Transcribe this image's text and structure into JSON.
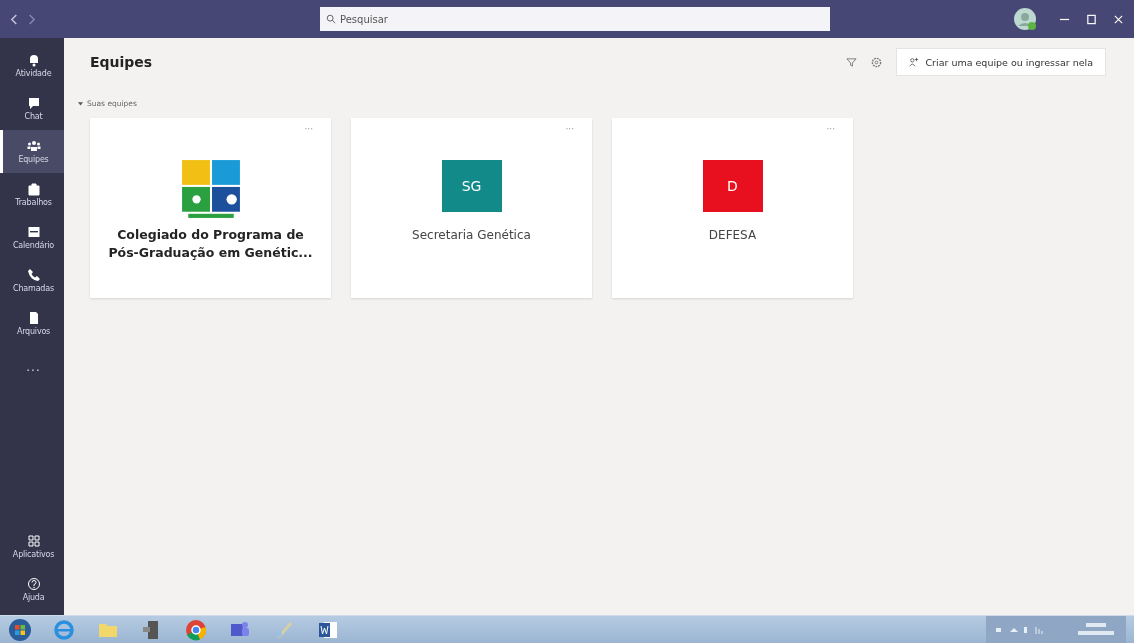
{
  "titlebar": {
    "search": {
      "placeholder": "Pesquisar"
    }
  },
  "sidebar": {
    "items": [
      {
        "label": "Atividade",
        "kind": "bell",
        "selected": false
      },
      {
        "label": "Chat",
        "kind": "chat",
        "selected": false
      },
      {
        "label": "Equipes",
        "kind": "teams",
        "selected": true
      },
      {
        "label": "Trabalhos",
        "kind": "bag",
        "selected": false
      },
      {
        "label": "Calendário",
        "kind": "calendar",
        "selected": false
      },
      {
        "label": "Chamadas",
        "kind": "phone",
        "selected": false
      },
      {
        "label": "Arquivos",
        "kind": "file",
        "selected": false
      },
      {
        "label": "...",
        "kind": "more",
        "selected": false
      }
    ],
    "bottom_items": [
      {
        "label": "Aplicativos",
        "kind": "apps",
        "selected": false
      },
      {
        "label": "Ajuda",
        "kind": "help",
        "selected": false
      }
    ]
  },
  "page": {
    "title": "Equipes",
    "create_button": "Criar uma equipe ou ingressar nela",
    "section": {
      "label": "Suas equipes",
      "expanded": true
    },
    "teams": [
      {
        "name": "Colegiado do Programa de Pós-Graduação em Genétic...",
        "kind": "logo",
        "menu": "···"
      },
      {
        "name": "Secretaria Genética",
        "kind": "initials",
        "initials": "SG",
        "color": "#128a8a",
        "menu": "···"
      },
      {
        "name": "DEFESA",
        "kind": "initials",
        "initials": "D",
        "color": "#e8101f",
        "menu": "···"
      }
    ]
  },
  "taskbar": {
    "apps": [
      {
        "kind": "start"
      },
      {
        "kind": "ie"
      },
      {
        "kind": "folder"
      },
      {
        "kind": "app"
      },
      {
        "kind": "chrome"
      },
      {
        "kind": "teams"
      },
      {
        "kind": "paint"
      },
      {
        "kind": "word"
      }
    ]
  }
}
